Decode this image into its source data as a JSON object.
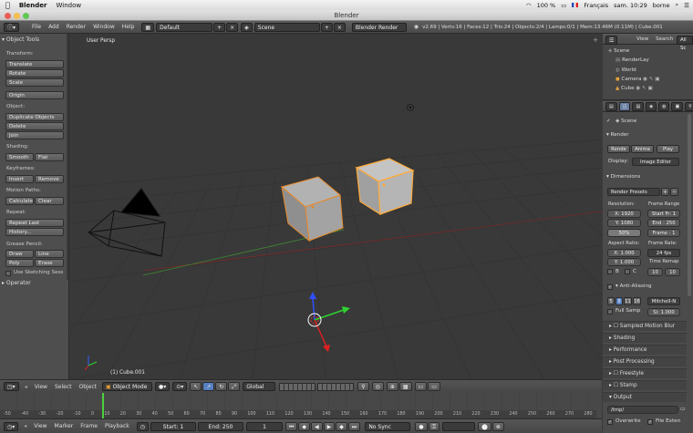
{
  "mac_menubar": {
    "apple": "",
    "app_name": "Blender",
    "window_menu": "Window",
    "battery": "100 %",
    "language": "Français",
    "datetime": "sam. 10:29",
    "user": "borne"
  },
  "window_title": "Blender",
  "info_header": {
    "menus": [
      "File",
      "Add",
      "Render",
      "Window",
      "Help"
    ],
    "layout": "Default",
    "scene": "Scene",
    "engine": "Blender Render",
    "stats": "v2.69 | Verts:16 | Faces:12 | Tris:24 | Objects:2/4 | Lamps:0/1 | Mem:13.46M (0.11M) | Cube.001"
  },
  "tool_shelf": {
    "title": "Object Tools",
    "transform_label": "Transform:",
    "translate": "Translate",
    "rotate": "Rotate",
    "scale": "Scale",
    "origin": "Origin",
    "object_label": "Object:",
    "duplicate": "Duplicate Objects",
    "delete": "Delete",
    "join": "Join",
    "shading_label": "Shading:",
    "smooth": "Smooth",
    "flat": "Flat",
    "keyframes_label": "Keyframes:",
    "insert": "Insert",
    "remove": "Remove",
    "motion_label": "Motion Paths:",
    "calculate": "Calculate",
    "clear": "Clear",
    "repeat_label": "Repeat:",
    "repeat_last": "Repeat Last",
    "history": "History...",
    "grease_label": "Grease Pencil:",
    "draw": "Draw",
    "line": "Line",
    "poly": "Poly",
    "erase": "Erase",
    "use_sketching": "Use Sketching Sess",
    "operator": "Operator"
  },
  "viewport": {
    "view_label": "User Persp",
    "object_label": "(1) Cube.001"
  },
  "outliner": {
    "view": "View",
    "search": "Search",
    "filter": "All Sc",
    "items": [
      "Scene",
      "RenderLay",
      "World",
      "Camera",
      "Cube"
    ]
  },
  "properties": {
    "scene_label": "Scene",
    "render_section": "Render",
    "render_btn": "Rende",
    "anim_btn": "Anima",
    "play_btn": "Play",
    "display_label": "Display:",
    "display_value": "Image Editor",
    "dimensions_section": "Dimensions",
    "presets": "Render Presets",
    "resolution_label": "Resolution:",
    "frame_range_label": "Frame Range",
    "res_x": "X: 1920",
    "res_y": "Y: 1080",
    "res_pct": "50%",
    "start_frame": "Start Fr: 1",
    "end_frame": "End : 250",
    "frame_step": "Frame : 1",
    "aspect_label": "Aspect Ratio:",
    "frame_rate_label": "Frame Rate:",
    "aspect_x": "X: 1.000",
    "aspect_y": "Y: 1.000",
    "fps": "24 fps",
    "time_remap_label": "Time Remap",
    "remap_old": "10",
    "remap_new": "10",
    "border_b": "B",
    "border_c": "C",
    "aa_section": "Anti-Aliasing",
    "aa_samples": [
      "5",
      "8",
      "11",
      "16"
    ],
    "aa_filter": "Mitchell-N",
    "full_sample": "Full Samp",
    "filter_size": "Si: 1.000",
    "sampled_mb": "Sampled Motion Blur",
    "shading": "Shading",
    "performance": "Performance",
    "post_processing": "Post Processing",
    "freestyle": "Freestyle",
    "stamp": "Stamp",
    "output": "Output",
    "output_path": "/tmp/",
    "overwrite": "Overwrite",
    "file_ext": "File Exten"
  },
  "viewport_header": {
    "view": "View",
    "select": "Select",
    "object": "Object",
    "mode": "Object Mode",
    "orientation": "Global"
  },
  "timeline": {
    "ticks": [
      "-50",
      "-40",
      "-30",
      "-20",
      "-10",
      "0",
      "10",
      "20",
      "30",
      "40",
      "50",
      "60",
      "70",
      "80",
      "90",
      "100",
      "110",
      "120",
      "130",
      "140",
      "150",
      "160",
      "170",
      "180",
      "190",
      "200",
      "210",
      "220",
      "230",
      "240",
      "250",
      "260",
      "270",
      "280"
    ],
    "current_frame_tick": "0"
  },
  "timeline_header": {
    "view": "View",
    "marker": "Marker",
    "frame": "Frame",
    "playback": "Playback",
    "start": "Start: 1",
    "end": "End: 250",
    "current": "1",
    "sync": "No Sync"
  }
}
